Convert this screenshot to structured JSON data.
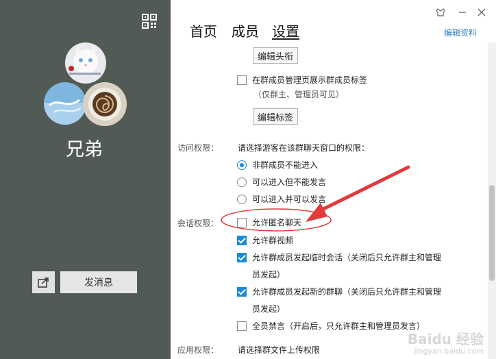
{
  "left": {
    "group_name": "兄弟",
    "send_label": "发消息",
    "icons": [
      "qr-code-icon",
      "share-icon"
    ],
    "bg_color": "#525a56"
  },
  "header": {
    "tabs": [
      "首页",
      "成员",
      "设置"
    ],
    "active_tab": "设置",
    "edit_profile": "编辑资料",
    "window_buttons": [
      "skin-icon",
      "minimize-icon",
      "close-icon"
    ]
  },
  "settings": {
    "edit_title_btn": "编辑头衔",
    "show_tags_label": "在群成员管理页展示群成员标签",
    "show_tags_hint": "（仅群主、管理员可见）",
    "edit_tags_btn": "编辑标签",
    "access": {
      "key": "访问权限：",
      "prompt": "请选择游客在该群聊天窗口的权限：",
      "options": [
        "非群成员不能进入",
        "可以进入但不能发言",
        "可以进入并可以发言"
      ],
      "selected": 0
    },
    "chat": {
      "key": "会话权限：",
      "anonymous": "允许匿名聊天",
      "video": "允许群视频",
      "temp_chat_1": "允许群成员发起临时会话（关闭后只允许群主和管理",
      "temp_chat_2": "员发起）",
      "new_group_1": "允许群成员发起新的群聊（关闭后只允许群主和管理",
      "new_group_2": "员发起）",
      "mute_all": "全员禁言（开启后，只允许群主和管理员发言）"
    },
    "app": {
      "key": "应用权限：",
      "prompt": "请选择群文件上传权限"
    }
  },
  "accent_color": "#1a8ad8",
  "annotation_color": "#e23b3b",
  "watermark": {
    "main": "Baidu 经验",
    "url": "jingyan.baidu.com"
  }
}
